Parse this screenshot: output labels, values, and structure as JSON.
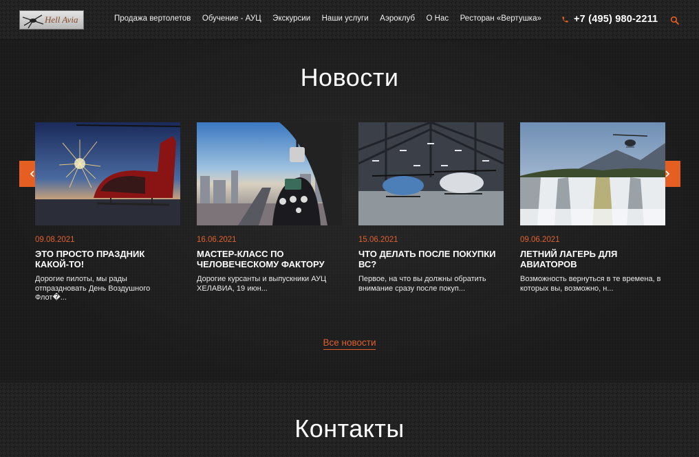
{
  "header": {
    "logo_text": "Hell Avia",
    "nav": [
      "Продажа вертолетов",
      "Обучение - АУЦ",
      "Экскурсии",
      "Наши услуги",
      "Аэроклуб",
      "О Нас",
      "Ресторан «Вертушка»"
    ],
    "phone": "+7 (495) 980-2211"
  },
  "news": {
    "title": "Новости",
    "cards": [
      {
        "date": "09.08.2021",
        "title": "Это просто праздник какой-то!",
        "text": "Дорогие пилоты, мы рады отпраздновать День Воздушного Флот�..."
      },
      {
        "date": "16.06.2021",
        "title": "Мастер-класс по человеческому фактору",
        "text": "Дорогие курсанты и выпускники АУЦ ХЕЛАВИА,  19 июн..."
      },
      {
        "date": "15.06.2021",
        "title": "Что делать после покупки ВС?",
        "text": "Первое, на что вы должны обратить внимание сразу после покуп..."
      },
      {
        "date": "09.06.2021",
        "title": "Летний лагерь для авиаторов",
        "text": "Возможность вернуться в те времена, в которых вы, возможно, н..."
      }
    ],
    "all_news_label": "Все новости"
  },
  "contacts": {
    "title": "Контакты"
  },
  "colors": {
    "accent": "#e65f22",
    "date": "#e0622a"
  },
  "icons": {
    "phone": "phone-icon",
    "search": "search-icon",
    "prev": "chevron-left-icon",
    "next": "chevron-right-icon"
  }
}
